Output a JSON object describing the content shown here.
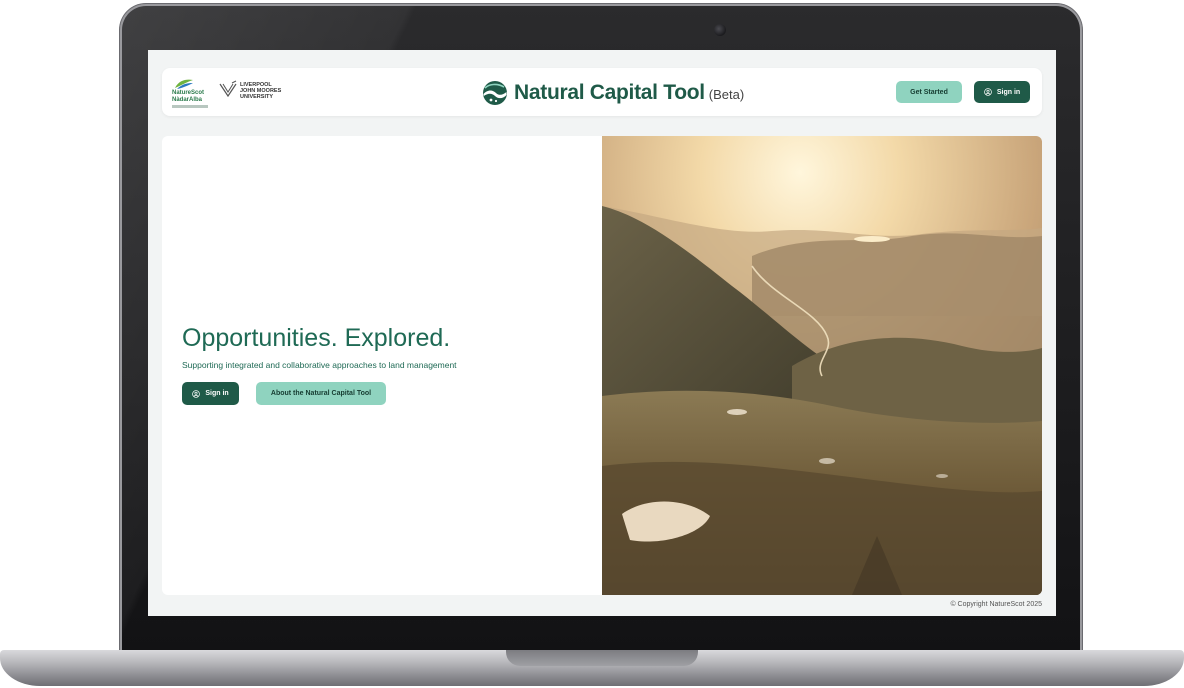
{
  "header": {
    "naturescot_logo": {
      "line1": "NatureScot",
      "line2": "NàdarAlba"
    },
    "ljmu_logo": {
      "text": "LIVERPOOL\nJOHN MOORES\nUNIVERSITY"
    },
    "brand": {
      "title": "Natural Capital Tool",
      "badge": "(Beta)"
    },
    "get_started_label": "Get Started",
    "sign_in_label": "Sign in"
  },
  "hero": {
    "title": "Opportunities. Explored.",
    "subtitle": "Supporting integrated and collaborative approaches to land management",
    "sign_in_label": "Sign in",
    "about_label": "About the Natural Capital Tool"
  },
  "footer": {
    "copyright": "© Copyright NatureScot 2025"
  },
  "colors": {
    "brand_green": "#1f5a48",
    "accent_mint": "#8fd3bf",
    "text_green": "#1f6a55"
  },
  "icons": {
    "user": "user-circle-icon",
    "brand": "globe-landscape-icon",
    "hero_image": "mountain-valley-sunset-image"
  }
}
